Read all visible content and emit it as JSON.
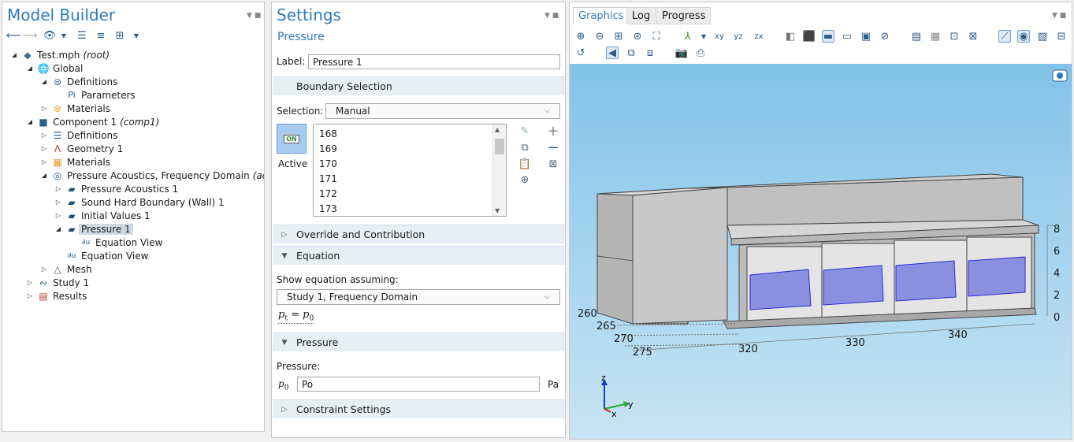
{
  "model_builder": {
    "title": "Model Builder",
    "tree": [
      {
        "label": "Test.mph",
        "suffix": "(root)"
      },
      {
        "label": "Global"
      },
      {
        "label": "Definitions"
      },
      {
        "label": "Parameters"
      },
      {
        "label": "Materials"
      },
      {
        "label": "Component 1",
        "suffix": "(comp1)"
      },
      {
        "label": "Definitions"
      },
      {
        "label": "Geometry 1"
      },
      {
        "label": "Materials"
      },
      {
        "label": "Pressure Acoustics, Frequency Domain",
        "suffix": "(acpr)"
      },
      {
        "label": "Pressure Acoustics 1"
      },
      {
        "label": "Sound Hard Boundary (Wall) 1"
      },
      {
        "label": "Initial Values 1"
      },
      {
        "label": "Pressure 1"
      },
      {
        "label": "Equation View"
      },
      {
        "label": "Equation View"
      },
      {
        "label": "Mesh"
      },
      {
        "label": "Study 1"
      },
      {
        "label": "Results"
      }
    ]
  },
  "settings": {
    "title": "Settings",
    "subtitle": "Pressure",
    "label_caption": "Label:",
    "label_value": "Pressure 1",
    "boundary_section": "Boundary Selection",
    "selection_caption": "Selection:",
    "selection_value": "Manual",
    "active_badge": "ON",
    "active_label": "Active",
    "boundaries": [
      "168",
      "169",
      "170",
      "171",
      "172",
      "173"
    ],
    "override_section": "Override and Contribution",
    "equation_section": "Equation",
    "show_eq_caption": "Show equation assuming:",
    "study_value": "Study 1, Frequency Domain",
    "equation_lhs": "p",
    "equation_lhs_sub": "t",
    "equation_eq": " = ",
    "equation_rhs": "p",
    "equation_rhs_sub": "0",
    "pressure_section": "Pressure",
    "pressure_caption": "Pressure:",
    "p0_symbol": "p",
    "p0_sub": "0",
    "pressure_value": "Po",
    "pressure_unit": "Pa",
    "constraint_section": "Constraint Settings"
  },
  "graphics": {
    "tabs": [
      "Graphics",
      "Log",
      "Progress"
    ],
    "axis_x_ticks": [
      "260",
      "265",
      "270",
      "275"
    ],
    "axis_y_ticks": [
      "320",
      "330",
      "340"
    ],
    "axis_z_ticks": [
      "8",
      "6",
      "4",
      "2",
      "0"
    ],
    "triad_z": "z",
    "triad_y": "y",
    "triad_x": "x",
    "view_toolbar_labels": [
      "xy",
      "yz",
      "zx"
    ]
  }
}
